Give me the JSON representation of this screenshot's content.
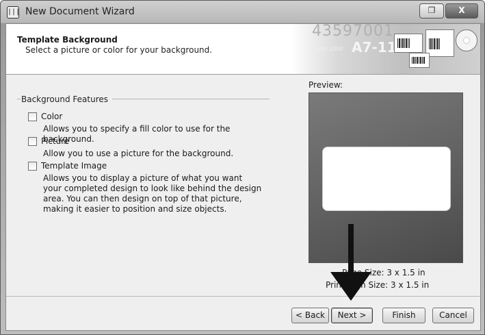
{
  "window": {
    "title": "New Document Wizard",
    "app_icon_text": "|||",
    "restore_glyph": "❐",
    "close_glyph": "X"
  },
  "header": {
    "title": "Template Background",
    "subtitle": "Select a picture or color for your background.",
    "banner_text_1": "43597001",
    "banner_text_2": "A7-118",
    "banner_small": "MAY 2000"
  },
  "features": {
    "group_label": "Background Features",
    "options": [
      {
        "label": "Color",
        "checked": false,
        "description": "Allows you to specify a fill color to use for the background."
      },
      {
        "label": "Picture",
        "checked": false,
        "description": "Allow you to use a picture for the background."
      },
      {
        "label": "Template Image",
        "checked": false,
        "description": "Allows you to display a picture of what you want your completed design to look like behind the design area. You can then design on top of that picture, making it easier to position and size objects."
      }
    ]
  },
  "preview": {
    "label": "Preview:",
    "page_size": "Page Size:  3 x 1.5 in",
    "print_item_size": "Print Item Size:  3 x 1.5 in",
    "background_color": "#666666"
  },
  "buttons": {
    "back": "< Back",
    "next": "Next >",
    "finish": "Finish",
    "cancel": "Cancel"
  },
  "annotation": {
    "arrow_icon": "down-arrow-icon",
    "color": "#111111"
  }
}
